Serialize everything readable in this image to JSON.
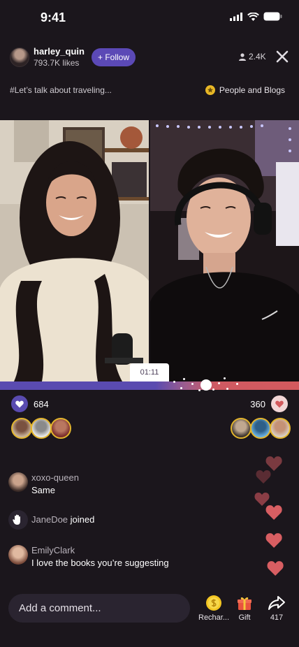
{
  "status": {
    "time": "9:41"
  },
  "host": {
    "name": "harley_quin",
    "likes": "793.7K likes",
    "follow_label": "+ Follow"
  },
  "stream": {
    "viewers": "2.4K",
    "topic": "#Let’s talk about traveling...",
    "category": "People and Blogs"
  },
  "battle": {
    "timer": "01:11",
    "left_score": "684",
    "right_score": "360",
    "left_share": 0.68
  },
  "chat": [
    {
      "type": "message",
      "user": "xoxo-queen",
      "text": "Same"
    },
    {
      "type": "join",
      "user": "JaneDoe",
      "text": "joined"
    },
    {
      "type": "message",
      "user": "EmilyClark",
      "text": "I love the books you’re suggesting"
    }
  ],
  "composer": {
    "placeholder": "Add a comment..."
  },
  "actions": {
    "recharge": "Rechar...",
    "gift": "Gift",
    "share_count": "417"
  },
  "colors": {
    "left_team": "#5a4bb0",
    "right_team": "#d35a5e",
    "accent": "#5b49b6",
    "background": "#1b161c"
  }
}
